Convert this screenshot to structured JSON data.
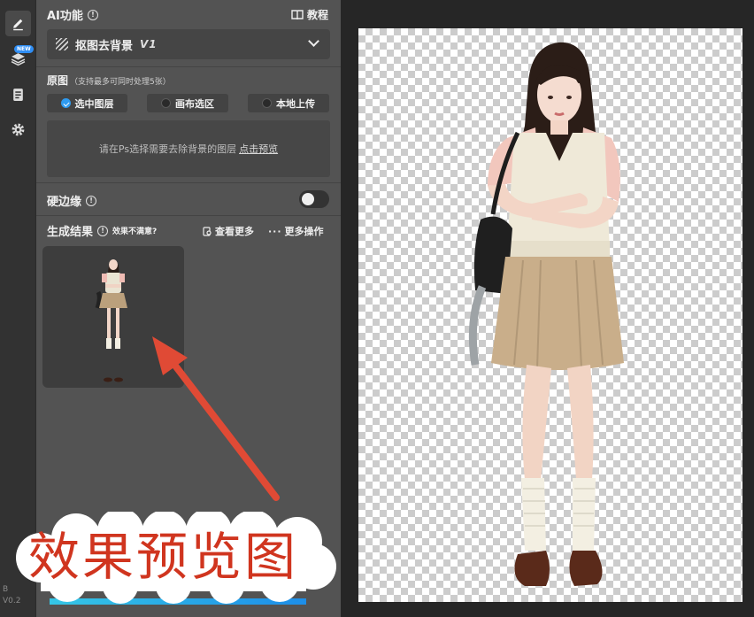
{
  "rail": {
    "items": [
      {
        "icon": "brush-icon",
        "active": true
      },
      {
        "icon": "layers-icon",
        "badge": "NEW"
      },
      {
        "icon": "clipboard-icon"
      },
      {
        "icon": "gear-icon"
      }
    ],
    "version_line1": "B",
    "version_line2": "V0.2"
  },
  "header": {
    "title": "AI功能",
    "tutorial_label": "教程"
  },
  "function_select": {
    "label": "抠图去背景",
    "version": "V1"
  },
  "source": {
    "label": "原图",
    "hint": "（支持最多可同时处理5张）",
    "options": [
      {
        "label": "选中图层",
        "checked": true
      },
      {
        "label": "画布选区",
        "checked": false
      },
      {
        "label": "本地上传",
        "checked": false
      }
    ],
    "dropzone_text": "请在Ps选择需要去除背景的图层",
    "dropzone_link": "点击预览"
  },
  "hard_edge": {
    "label": "硬边缘",
    "enabled": false
  },
  "results": {
    "label": "生成结果",
    "unsatisfied": "效果不满意?",
    "view_more": "查看更多",
    "more_actions": "更多操作"
  },
  "overlay_caption": "效果预览图",
  "colors": {
    "accent": "#2f9bf0",
    "arrow": "#e04a35",
    "caption": "#d0351f"
  }
}
